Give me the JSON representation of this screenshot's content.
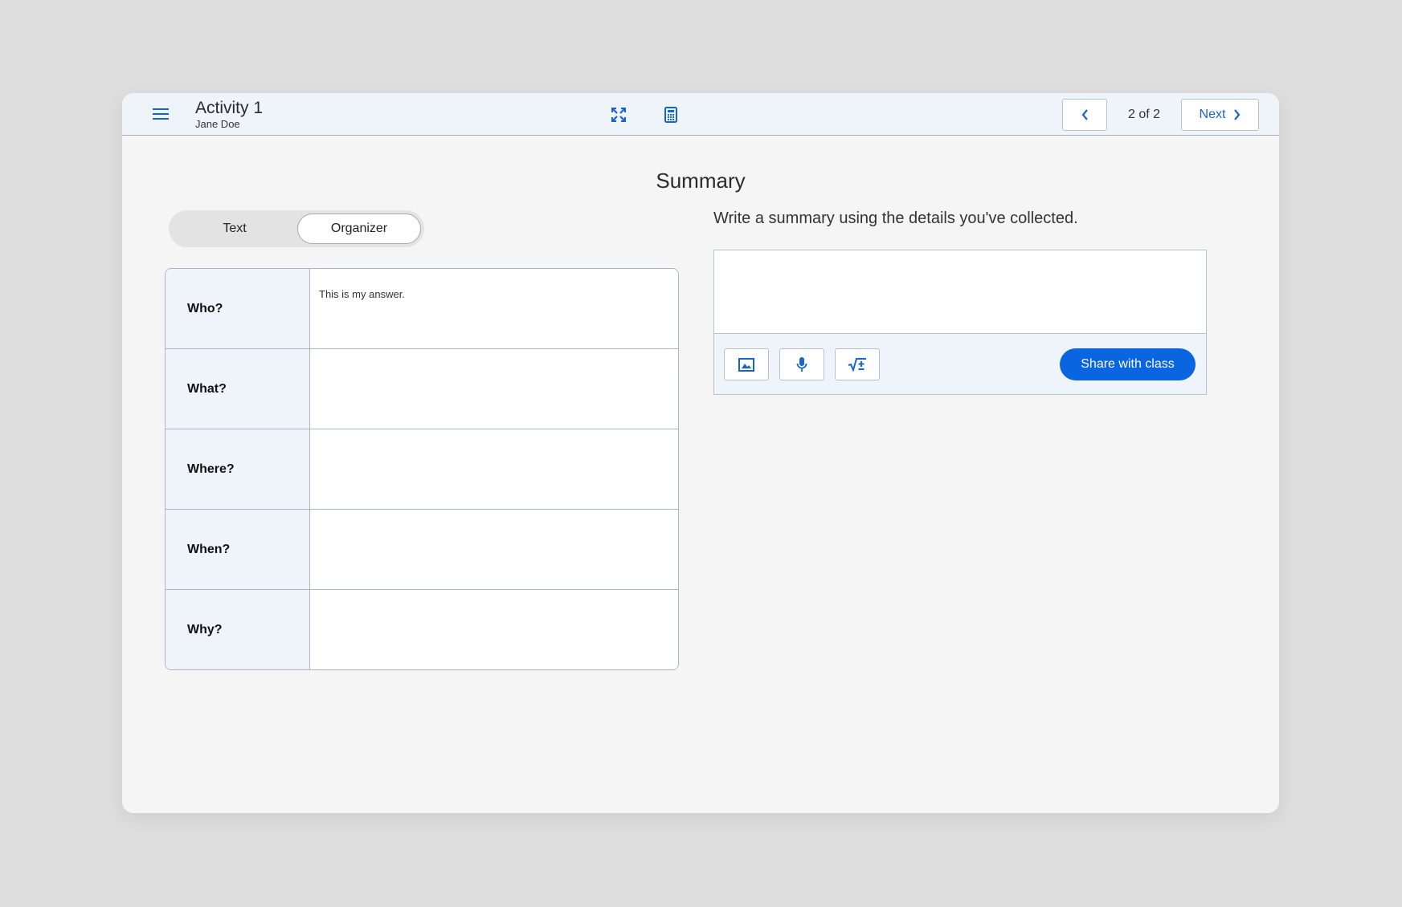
{
  "header": {
    "activity_title": "Activity 1",
    "student_name": "Jane Doe",
    "page_counter": "2 of 2",
    "next_label": "Next",
    "icons": {
      "menu": "hamburger-menu-icon",
      "fullscreen": "fullscreen-expand-icon",
      "calculator": "calculator-icon",
      "prev": "chevron-left-icon",
      "next": "chevron-right-icon"
    }
  },
  "main": {
    "heading": "Summary",
    "toggle": {
      "options": [
        "Text",
        "Organizer"
      ],
      "selected": "Organizer"
    },
    "organizer": {
      "rows": [
        {
          "label": "Who?",
          "answer": "This is my answer."
        },
        {
          "label": "What?",
          "answer": ""
        },
        {
          "label": "Where?",
          "answer": ""
        },
        {
          "label": "When?",
          "answer": ""
        },
        {
          "label": "Why?",
          "answer": ""
        }
      ]
    },
    "prompt": "Write a summary using the details you've collected.",
    "summary": {
      "value": "",
      "tools": [
        "image-icon",
        "microphone-icon",
        "math-equation-icon"
      ],
      "share_label": "Share with class"
    }
  },
  "colors": {
    "accent": "#0a65e0",
    "header_bg": "#eff4fb",
    "page_bg": "#f5f5f5",
    "backdrop": "#dedede"
  }
}
